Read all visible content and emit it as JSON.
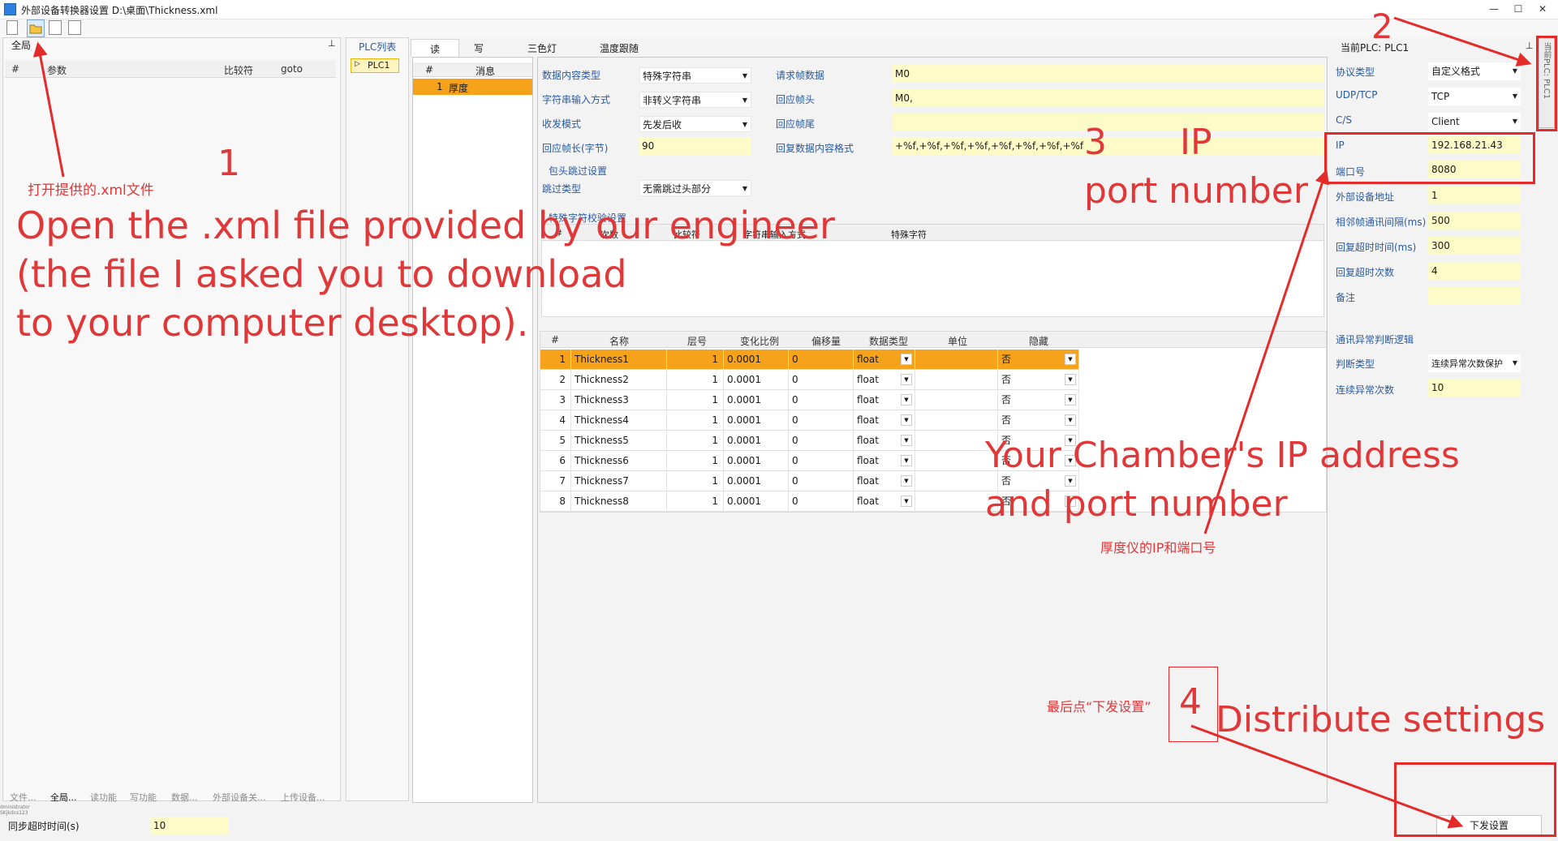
{
  "window": {
    "title": "外部设备转换器设置 D:\\桌面\\Thickness.xml",
    "minimize": "—",
    "maximize": "☐",
    "close": "✕"
  },
  "toolbar": {
    "tooltip": "打开"
  },
  "left": {
    "header": "全局",
    "pin": "⊥",
    "columns": [
      "#",
      "参数",
      "比较符",
      "goto"
    ],
    "tabs": [
      "文件...",
      "全局...",
      "读功能",
      "写功能",
      "数据...",
      "外部设备关...",
      "上传设备..."
    ],
    "tiny_text": "dministrator\nSKjkdcs123",
    "sync_timeout_label": "同步超时时间(s)",
    "sync_timeout_value": "10"
  },
  "plc_list": {
    "header": "PLC列表",
    "item": "PLC1"
  },
  "tabs": [
    "读",
    "写",
    "三色灯",
    "温度跟随"
  ],
  "messages": {
    "columns": [
      "#",
      "消息"
    ],
    "row_index": "1",
    "row_label": "厚度"
  },
  "fields": {
    "content_type_label": "数据内容类型",
    "content_type_value": "特殊字符串",
    "input_mode_label": "字符串输入方式",
    "input_mode_value": "非转义字符串",
    "txrx_label": "收发模式",
    "txrx_value": "先发后收",
    "resp_len_label": "回应帧长(字节)",
    "resp_len_value": "90",
    "req_data_label": "请求帧数据",
    "req_data_value": "M0",
    "resp_head_label": "回应帧头",
    "resp_head_value": "M0,",
    "resp_tail_label": "回应帧尾",
    "resp_tail_value": "",
    "resp_format_label": "回复数据内容格式",
    "resp_format_value": "+%f,+%f,+%f,+%f,+%f,+%f,+%f,+%f",
    "skip_group_label": "包头跳过设置",
    "skip_type_label": "跳过类型",
    "skip_type_value": "无需跳过头部分",
    "special_group_label": "特殊字符校验设置",
    "special_columns": [
      "#",
      "次数",
      "比较符",
      "字符串输入方式",
      "特殊字符"
    ]
  },
  "table": {
    "columns": [
      "#",
      "名称",
      "层号",
      "变化比例",
      "偏移量",
      "数据类型",
      "单位",
      "隐藏"
    ],
    "rows": [
      {
        "idx": "1",
        "name": "Thickness1",
        "layer": "1",
        "ratio": "0.0001",
        "offset": "0",
        "dtype": "float",
        "unit": "",
        "hidden": "否"
      },
      {
        "idx": "2",
        "name": "Thickness2",
        "layer": "1",
        "ratio": "0.0001",
        "offset": "0",
        "dtype": "float",
        "unit": "",
        "hidden": "否"
      },
      {
        "idx": "3",
        "name": "Thickness3",
        "layer": "1",
        "ratio": "0.0001",
        "offset": "0",
        "dtype": "float",
        "unit": "",
        "hidden": "否"
      },
      {
        "idx": "4",
        "name": "Thickness4",
        "layer": "1",
        "ratio": "0.0001",
        "offset": "0",
        "dtype": "float",
        "unit": "",
        "hidden": "否"
      },
      {
        "idx": "5",
        "name": "Thickness5",
        "layer": "1",
        "ratio": "0.0001",
        "offset": "0",
        "dtype": "float",
        "unit": "",
        "hidden": "否"
      },
      {
        "idx": "6",
        "name": "Thickness6",
        "layer": "1",
        "ratio": "0.0001",
        "offset": "0",
        "dtype": "float",
        "unit": "",
        "hidden": "否"
      },
      {
        "idx": "7",
        "name": "Thickness7",
        "layer": "1",
        "ratio": "0.0001",
        "offset": "0",
        "dtype": "float",
        "unit": "",
        "hidden": "否"
      },
      {
        "idx": "8",
        "name": "Thickness8",
        "layer": "1",
        "ratio": "0.0001",
        "offset": "0",
        "dtype": "float",
        "unit": "",
        "hidden": "否"
      }
    ]
  },
  "right": {
    "header": "当前PLC: PLC1",
    "pin": "⊥",
    "protocol_label": "协议类型",
    "protocol_value": "自定义格式",
    "transport_label": "UDP/TCP",
    "transport_value": "TCP",
    "cs_label": "C/S",
    "cs_value": "Client",
    "ip_label": "IP",
    "ip_value": "192.168.21.43",
    "port_label": "端口号",
    "port_value": "8080",
    "ext_addr_label": "外部设备地址",
    "ext_addr_value": "1",
    "interval_label": "相邻帧通讯间隔(ms)",
    "interval_value": "500",
    "timeout_label": "回复超时时间(ms)",
    "timeout_value": "300",
    "timeout_count_label": "回复超时次数",
    "timeout_count_value": "4",
    "note_label": "备注",
    "note_value": "",
    "abnormal_group_label": "通讯异常判断逻辑",
    "judge_type_label": "判断类型",
    "judge_type_value": "连续异常次数保护",
    "abnormal_count_label": "连续异常次数",
    "abnormal_count_value": "10",
    "side_tab": "当前PLC: PLC1",
    "send_button": "下发设置"
  },
  "annotations": {
    "step1_number": "1",
    "step1_cn": "打开提供的.xml文件",
    "step1_en": [
      "Open the .xml file provided by our engineer",
      "(the file I asked you to download",
      "to your computer desktop)."
    ],
    "step2_number": "2",
    "step3_number": "3",
    "step3_ip": "IP",
    "step3_port": "port number",
    "step3_en": [
      "Your Chamber's IP address",
      "and port number"
    ],
    "step3_cn": "厚度仪的IP和端口号",
    "step4_number": "4",
    "step4_cn": "最后点“下发设置”",
    "step4_en": "Distribute settings"
  }
}
